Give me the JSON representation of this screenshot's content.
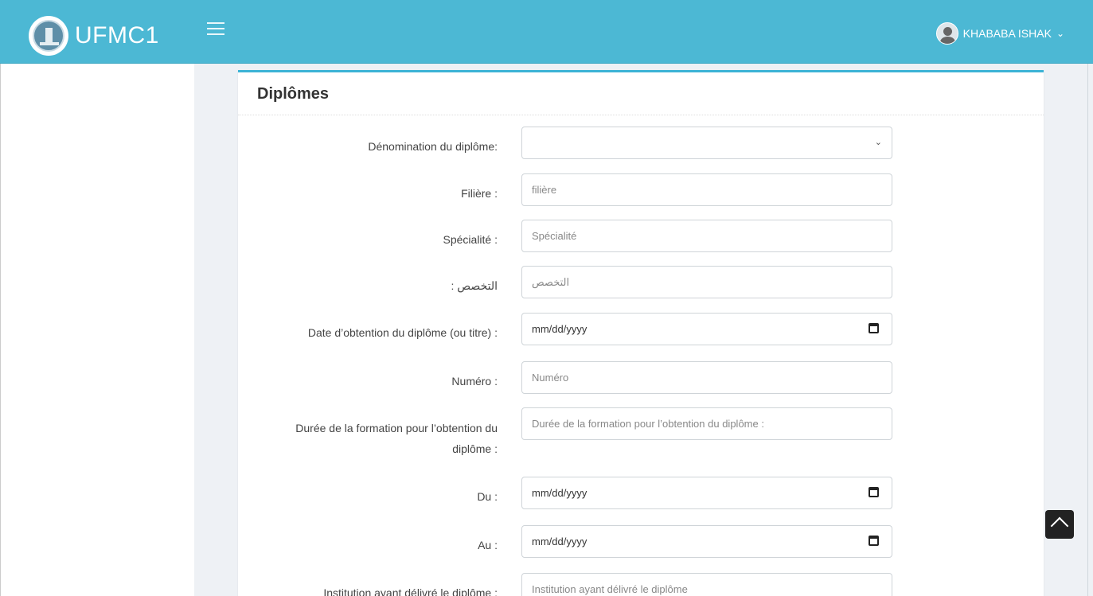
{
  "header": {
    "brand": "UFMC1",
    "user_name": "KHABABA ISHAK",
    "user_chevron": "⌄"
  },
  "card": {
    "title": "Diplômes"
  },
  "form": {
    "denomination_label": "Dénomination du diplôme:",
    "denomination_value": "",
    "filiere_label": "Filière :",
    "filiere_placeholder": "filière",
    "specialite_label": "Spécialité :",
    "specialite_placeholder": "Spécialité",
    "takhasous_label": ": التخصص",
    "takhasous_placeholder": "التخصص",
    "date_obtention_label": "Date d’obtention du diplôme (ou titre) :",
    "date_obtention_value": "mm/dd/yyyy",
    "numero_label": "Numéro :",
    "numero_placeholder": "Numéro",
    "duree_label_line1": "Durée de la formation pour l’obtention du",
    "duree_label_line2": "diplôme :",
    "duree_placeholder": "Durée de la formation pour l’obtention du diplôme :",
    "du_label": "Du :",
    "du_value": "mm/dd/yyyy",
    "au_label": "Au :",
    "au_value": "mm/dd/yyyy",
    "institution_label": "Institution ayant délivré le diplôme :",
    "institution_placeholder": "Institution ayant délivré le diplôme"
  },
  "icons": {
    "calendar": "calendar-icon",
    "scroll_top": "chevron-up-icon",
    "menu": "hamburger-icon"
  },
  "colors": {
    "topbar": "#4cb8d4",
    "card_accent": "#3cb3d6"
  }
}
